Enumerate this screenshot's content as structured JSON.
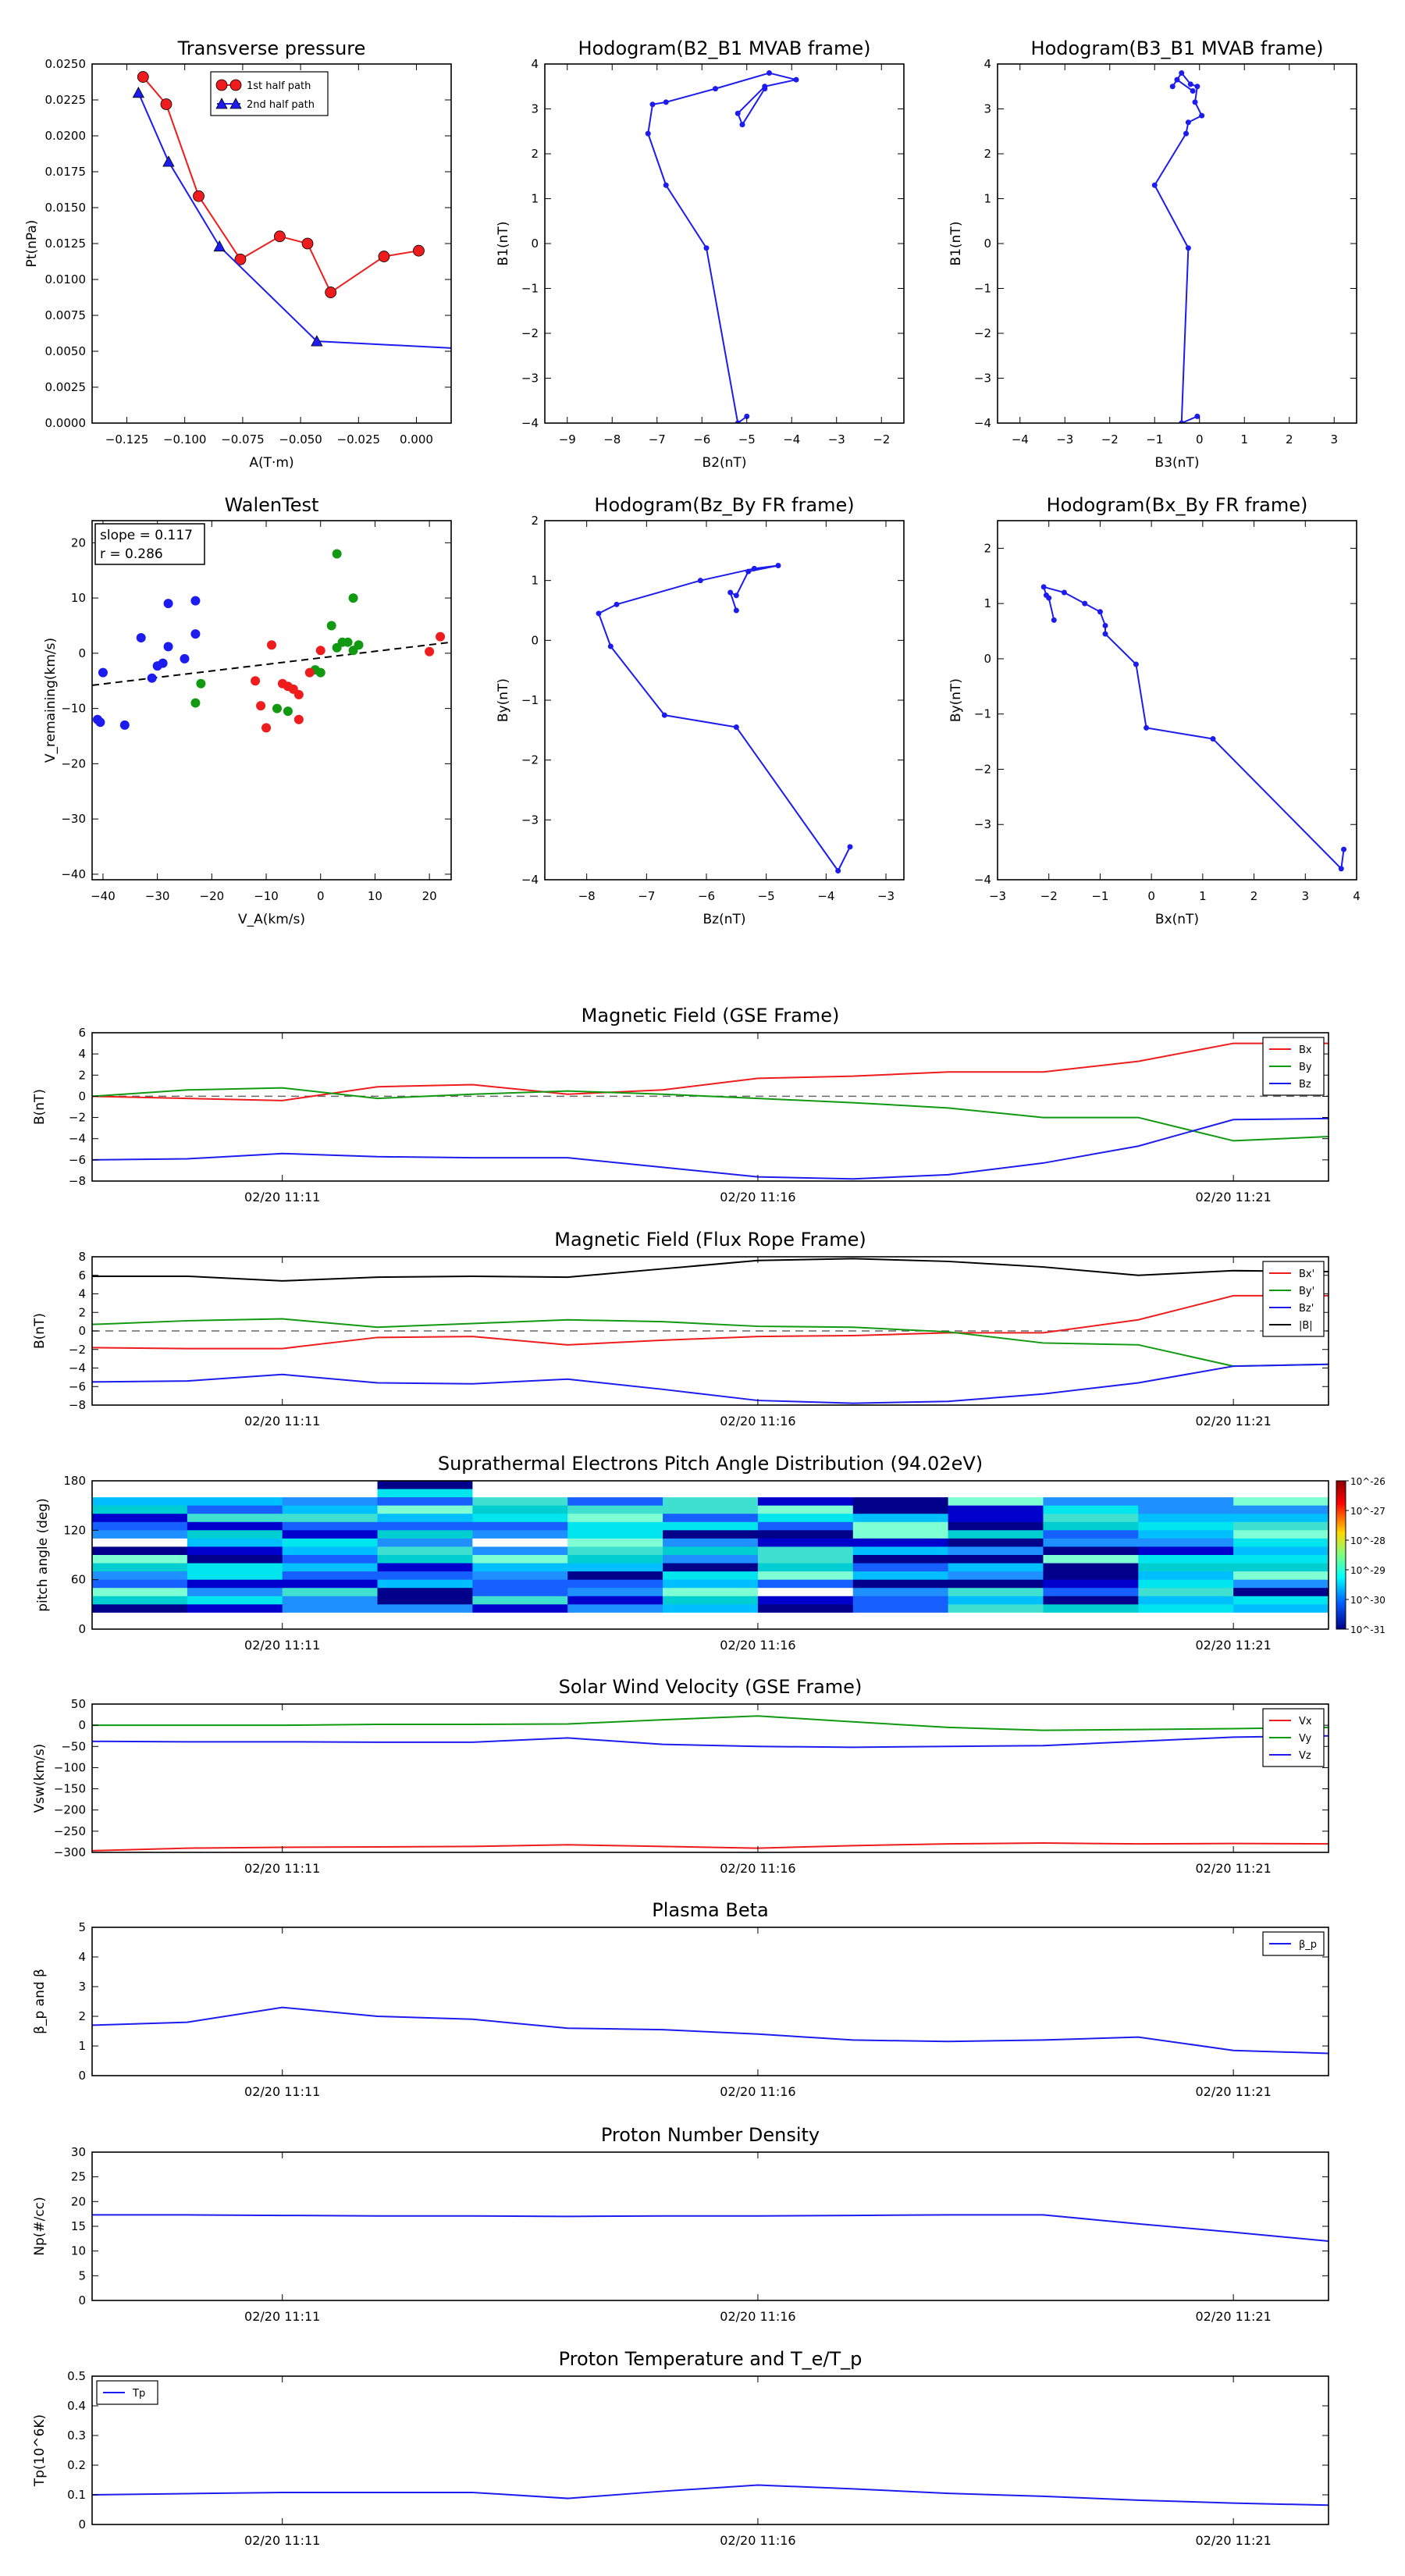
{
  "chart_data": [
    {
      "id": "tp",
      "type": "scatter",
      "title": "Transverse pressure",
      "xlabel": "A(T·m)",
      "ylabel": "Pt(nPa)",
      "xlim": [
        -0.14,
        0.015
      ],
      "ylim": [
        0,
        0.025
      ],
      "xticks": [
        -0.125,
        -0.1,
        -0.075,
        -0.05,
        -0.025,
        0.0
      ],
      "xtick_labels": [
        "−0.125",
        "−0.100",
        "−0.075",
        "−0.050",
        "−0.025",
        "0.000"
      ],
      "yticks": [
        0,
        0.0025,
        0.005,
        0.0075,
        0.01,
        0.0125,
        0.015,
        0.0175,
        0.02,
        0.0225,
        0.025
      ],
      "ytick_labels": [
        "0.0000",
        "0.0025",
        "0.0050",
        "0.0075",
        "0.0100",
        "0.0125",
        "0.0150",
        "0.0175",
        "0.0200",
        "0.0225",
        "0.0250"
      ],
      "legend": "upper-center",
      "series": [
        {
          "name": "1st half path",
          "color": "#ee1c1c",
          "marker": "circle",
          "x": [
            -0.118,
            -0.108,
            -0.094,
            -0.076,
            -0.059,
            -0.047,
            -0.037,
            -0.014,
            0.001
          ],
          "y": [
            0.0241,
            0.0222,
            0.0158,
            0.0114,
            0.013,
            0.0125,
            0.0091,
            0.0116,
            0.012
          ]
        },
        {
          "name": "2nd half path",
          "color": "#1c1cee",
          "marker": "triangle",
          "x": [
            -0.12,
            -0.107,
            -0.085,
            -0.043,
            0.018
          ],
          "y": [
            0.023,
            0.0182,
            0.0123,
            0.0057,
            0.0052
          ]
        }
      ]
    },
    {
      "id": "h1",
      "type": "line",
      "title": "Hodogram(B2_B1 MVAB frame)",
      "xlabel": "B2(nT)",
      "ylabel": "B1(nT)",
      "xlim": [
        -9.5,
        -1.5
      ],
      "ylim": [
        -4,
        4
      ],
      "xticks": [
        -9,
        -8,
        -7,
        -6,
        -5,
        -4,
        -3,
        -2
      ],
      "yticks": [
        -4,
        -3,
        -2,
        -1,
        0,
        1,
        2,
        3,
        4
      ],
      "series": [
        {
          "color": "#1c1cee",
          "x": [
            -5.0,
            -5.2,
            -5.9,
            -6.8,
            -7.2,
            -7.1,
            -6.8,
            -5.7,
            -4.5,
            -3.9,
            -4.6,
            -5.2,
            -5.1,
            -4.6
          ],
          "y": [
            -3.85,
            -4.0,
            -0.1,
            1.3,
            2.45,
            3.1,
            3.15,
            3.45,
            3.8,
            3.65,
            3.5,
            2.9,
            2.65,
            3.45
          ]
        }
      ]
    },
    {
      "id": "h2",
      "type": "line",
      "title": "Hodogram(B3_B1 MVAB frame)",
      "xlabel": "B3(nT)",
      "ylabel": "B1(nT)",
      "xlim": [
        -4.5,
        3.5
      ],
      "ylim": [
        -4,
        4
      ],
      "xticks": [
        -4,
        -3,
        -2,
        -1,
        0,
        1,
        2,
        3
      ],
      "yticks": [
        -4,
        -3,
        -2,
        -1,
        0,
        1,
        2,
        3,
        4
      ],
      "series": [
        {
          "color": "#1c1cee",
          "x": [
            -0.05,
            -0.4,
            -0.25,
            -1.0,
            -0.3,
            -0.25,
            0.05,
            -0.1,
            -0.05,
            -0.2,
            -0.4,
            -0.6,
            -0.5,
            -0.15
          ],
          "y": [
            -3.85,
            -4.0,
            -0.1,
            1.3,
            2.45,
            2.7,
            2.85,
            3.15,
            3.5,
            3.55,
            3.8,
            3.5,
            3.65,
            3.4
          ]
        }
      ]
    },
    {
      "id": "walen",
      "type": "scatter",
      "title": "WalenTest",
      "xlabel": "V_A(km/s)",
      "ylabel": "V_remaining(km/s)",
      "xlim": [
        -42,
        24
      ],
      "ylim": [
        -41,
        24
      ],
      "xticks": [
        -40,
        -30,
        -20,
        -10,
        0,
        10,
        20
      ],
      "yticks": [
        -40,
        -30,
        -20,
        -10,
        0,
        10,
        20
      ],
      "annotation": [
        "slope = 0.117",
        "r = 0.286"
      ],
      "fit_line": {
        "x": [
          -42,
          24
        ],
        "y": [
          -5.8,
          2.0
        ]
      },
      "series": [
        {
          "color": "#1c1cee",
          "x": [
            -41,
            -40.5,
            -40,
            -36,
            -33,
            -31,
            -30,
            -29,
            -28,
            -28,
            -25,
            -23,
            -23
          ],
          "y": [
            -12,
            -12.5,
            -3.5,
            -13,
            2.8,
            -4.5,
            -2.3,
            -1.8,
            9,
            1.2,
            -1,
            9.5,
            3.5
          ]
        },
        {
          "color": "#119911",
          "x": [
            -23,
            -22,
            -6,
            -8,
            2,
            3,
            4,
            5,
            6,
            6,
            7,
            3,
            0,
            -1
          ],
          "y": [
            -9,
            -5.5,
            -10.5,
            -10,
            5,
            18,
            2,
            2,
            10,
            0.5,
            1.5,
            1,
            -3.5,
            -3
          ]
        },
        {
          "color": "#ee1c1c",
          "x": [
            -12,
            -11,
            -9,
            -7,
            -6,
            -5,
            -4,
            -4,
            -2,
            0,
            20,
            22,
            -10
          ],
          "y": [
            -5,
            -9.5,
            1.5,
            -5.5,
            -6,
            -6.5,
            -7.5,
            -12,
            -3.5,
            0.5,
            0.3,
            3,
            -13.5
          ]
        }
      ]
    },
    {
      "id": "h3",
      "type": "line",
      "title": "Hodogram(Bz_By FR frame)",
      "xlabel": "Bz(nT)",
      "ylabel": "By(nT)",
      "xlim": [
        -8.7,
        -2.7
      ],
      "ylim": [
        -4,
        2
      ],
      "xticks": [
        -8,
        -7,
        -6,
        -5,
        -4,
        -3
      ],
      "yticks": [
        -4,
        -3,
        -2,
        -1,
        0,
        1,
        2
      ],
      "series": [
        {
          "color": "#1c1cee",
          "x": [
            -3.6,
            -3.8,
            -5.5,
            -6.7,
            -7.6,
            -7.8,
            -7.5,
            -6.1,
            -5.2,
            -4.8,
            -5.3,
            -5.5,
            -5.6,
            -5.5
          ],
          "y": [
            -3.45,
            -3.85,
            -1.45,
            -1.25,
            -0.1,
            0.45,
            0.6,
            1.0,
            1.2,
            1.25,
            1.15,
            0.75,
            0.8,
            0.5
          ]
        }
      ]
    },
    {
      "id": "h4",
      "type": "line",
      "title": "Hodogram(Bx_By FR frame)",
      "xlabel": "Bx(nT)",
      "ylabel": "By(nT)",
      "xlim": [
        -3,
        4
      ],
      "ylim": [
        -4,
        2.5
      ],
      "xticks": [
        -3,
        -2,
        -1,
        0,
        1,
        2,
        3,
        4
      ],
      "yticks": [
        -4,
        -3,
        -2,
        -1,
        0,
        1,
        2
      ],
      "series": [
        {
          "color": "#1c1cee",
          "x": [
            3.75,
            3.7,
            1.2,
            -0.1,
            -0.3,
            -0.9,
            -0.9,
            -1.0,
            -1.3,
            -1.7,
            -2.1,
            -2.05,
            -2.0,
            -1.9
          ],
          "y": [
            -3.45,
            -3.8,
            -1.45,
            -1.25,
            -0.1,
            0.45,
            0.6,
            0.85,
            1.0,
            1.2,
            1.3,
            1.15,
            1.1,
            0.7
          ]
        }
      ]
    },
    {
      "id": "ts1",
      "type": "line",
      "title": "Magnetic Field (GSE Frame)",
      "ylabel": "B(nT)",
      "ylim": [
        -8,
        6
      ],
      "yticks": [
        -8,
        -6,
        -4,
        -2,
        0,
        2,
        4,
        6
      ],
      "x_count": 13,
      "xtick_positions": [
        2,
        7,
        12
      ],
      "xtick_labels": [
        "02/20 11:11",
        "02/20 11:16",
        "02/20 11:21"
      ],
      "zero_line": true,
      "legend": "right",
      "series": [
        {
          "name": "Bx",
          "color": "#ee1c1c",
          "values": [
            0.0,
            -0.2,
            -0.4,
            0.9,
            1.1,
            0.2,
            0.6,
            1.7,
            1.9,
            2.3,
            2.3,
            3.3,
            5.0,
            5.0
          ]
        },
        {
          "name": "By",
          "color": "#119911",
          "values": [
            0.0,
            0.6,
            0.8,
            -0.2,
            0.2,
            0.5,
            0.2,
            -0.2,
            -0.6,
            -1.1,
            -2.0,
            -2.0,
            -4.2,
            -3.8
          ]
        },
        {
          "name": "Bz",
          "color": "#1c1cee",
          "values": [
            -6.0,
            -5.9,
            -5.4,
            -5.7,
            -5.8,
            -5.8,
            -6.7,
            -7.6,
            -7.8,
            -7.4,
            -6.3,
            -4.7,
            -2.2,
            -2.1
          ]
        }
      ]
    },
    {
      "id": "ts2",
      "type": "line",
      "title": "Magnetic Field (Flux Rope Frame)",
      "ylabel": "B(nT)",
      "ylim": [
        -8,
        8
      ],
      "yticks": [
        -8,
        -6,
        -4,
        -2,
        0,
        2,
        4,
        6,
        8
      ],
      "x_count": 13,
      "xtick_positions": [
        2,
        7,
        12
      ],
      "xtick_labels": [
        "02/20 11:11",
        "02/20 11:16",
        "02/20 11:21"
      ],
      "zero_line": true,
      "legend": "right",
      "series": [
        {
          "name": "Bx'",
          "color": "#ee1c1c",
          "values": [
            -1.8,
            -1.9,
            -1.9,
            -0.7,
            -0.6,
            -1.5,
            -1.0,
            -0.6,
            -0.5,
            -0.2,
            -0.2,
            1.2,
            3.8,
            3.8
          ]
        },
        {
          "name": "By'",
          "color": "#119911",
          "values": [
            0.7,
            1.1,
            1.3,
            0.4,
            0.8,
            1.2,
            1.0,
            0.5,
            0.4,
            -0.1,
            -1.3,
            -1.5,
            -3.8,
            -3.6
          ]
        },
        {
          "name": "Bz'",
          "color": "#1c1cee",
          "values": [
            -5.5,
            -5.4,
            -4.7,
            -5.6,
            -5.7,
            -5.2,
            -6.3,
            -7.5,
            -7.8,
            -7.6,
            -6.8,
            -5.6,
            -3.8,
            -3.6
          ]
        },
        {
          "name": "|B|",
          "color": "#000000",
          "values": [
            5.9,
            5.9,
            5.4,
            5.8,
            5.9,
            5.8,
            6.7,
            7.6,
            7.8,
            7.5,
            6.9,
            6.0,
            6.5,
            6.4
          ]
        }
      ]
    },
    {
      "id": "pad",
      "type": "heatmap",
      "title": "Suprathermal Electrons Pitch Angle Distribution (94.02eV)",
      "ylabel": "pitch angle (deg)",
      "ylim": [
        0,
        180
      ],
      "yticks": [
        0,
        60,
        120,
        180
      ],
      "xtick_labels": [
        "02/20 11:11",
        "02/20 11:16",
        "02/20 11:21"
      ],
      "colorbar_labels": [
        "10^-26",
        "10^-27",
        "10^-28",
        "10^-29",
        "10^-30",
        "10^-31"
      ],
      "columns": 13
    },
    {
      "id": "ts3",
      "type": "line",
      "title": "Solar Wind Velocity (GSE Frame)",
      "ylabel": "Vsw(km/s)",
      "ylim": [
        -300,
        50
      ],
      "yticks": [
        -300,
        -250,
        -200,
        -150,
        -100,
        -50,
        0,
        50
      ],
      "x_count": 13,
      "xtick_positions": [
        2,
        7,
        12
      ],
      "xtick_labels": [
        "02/20 11:11",
        "02/20 11:16",
        "02/20 11:21"
      ],
      "zero_line": false,
      "legend": "right",
      "series": [
        {
          "name": "Vx",
          "color": "#ee1c1c",
          "values": [
            -296,
            -290,
            -288,
            -287,
            -286,
            -282,
            -286,
            -290,
            -284,
            -280,
            -278,
            -280,
            -279,
            -280
          ]
        },
        {
          "name": "Vy",
          "color": "#119911",
          "values": [
            0,
            0,
            0,
            2,
            2,
            3,
            13,
            22,
            8,
            -5,
            -12,
            -10,
            -8,
            -5
          ]
        },
        {
          "name": "Vz",
          "color": "#1c1cee",
          "values": [
            -38,
            -39,
            -39,
            -40,
            -40,
            -30,
            -45,
            -50,
            -52,
            -50,
            -48,
            -38,
            -28,
            -25
          ]
        }
      ]
    },
    {
      "id": "ts4",
      "type": "line",
      "title": "Plasma Beta",
      "ylabel": "β_p and β",
      "ylim": [
        0,
        5
      ],
      "yticks": [
        0,
        1,
        2,
        3,
        4,
        5
      ],
      "x_count": 13,
      "xtick_positions": [
        2,
        7,
        12
      ],
      "xtick_labels": [
        "02/20 11:11",
        "02/20 11:16",
        "02/20 11:21"
      ],
      "zero_line": false,
      "legend": "right",
      "series": [
        {
          "name": "β_p",
          "color": "#1c1cee",
          "values": [
            1.7,
            1.8,
            2.3,
            2.0,
            1.9,
            1.6,
            1.55,
            1.4,
            1.2,
            1.15,
            1.2,
            1.3,
            0.85,
            0.75
          ]
        }
      ]
    },
    {
      "id": "ts5",
      "type": "line",
      "title": "Proton Number Density",
      "ylabel": "Np(#/cc)",
      "ylim": [
        0,
        30
      ],
      "yticks": [
        0,
        5,
        10,
        15,
        20,
        25,
        30
      ],
      "x_count": 13,
      "xtick_positions": [
        2,
        7,
        12
      ],
      "xtick_labels": [
        "02/20 11:11",
        "02/20 11:16",
        "02/20 11:21"
      ],
      "zero_line": false,
      "legend": "none",
      "series": [
        {
          "color": "#1c1cee",
          "values": [
            17.3,
            17.3,
            17.2,
            17.1,
            17.1,
            17.0,
            17.1,
            17.1,
            17.2,
            17.3,
            17.3,
            15.5,
            13.8,
            12.0
          ]
        }
      ]
    },
    {
      "id": "ts6",
      "type": "line",
      "title": "Proton Temperature and T_e/T_p",
      "ylabel": "Tp(10^6K)",
      "ylim": [
        0,
        0.5
      ],
      "yticks": [
        0,
        0.1,
        0.2,
        0.3,
        0.4,
        0.5
      ],
      "x_count": 13,
      "xtick_positions": [
        2,
        7,
        12
      ],
      "xtick_labels": [
        "02/20 11:11",
        "02/20 11:16",
        "02/20 11:21"
      ],
      "zero_line": false,
      "legend": "left",
      "series": [
        {
          "name": "Tp",
          "color": "#1c1cee",
          "values": [
            0.1,
            0.104,
            0.108,
            0.108,
            0.108,
            0.088,
            0.112,
            0.133,
            0.12,
            0.105,
            0.095,
            0.082,
            0.072,
            0.065
          ]
        }
      ]
    }
  ]
}
